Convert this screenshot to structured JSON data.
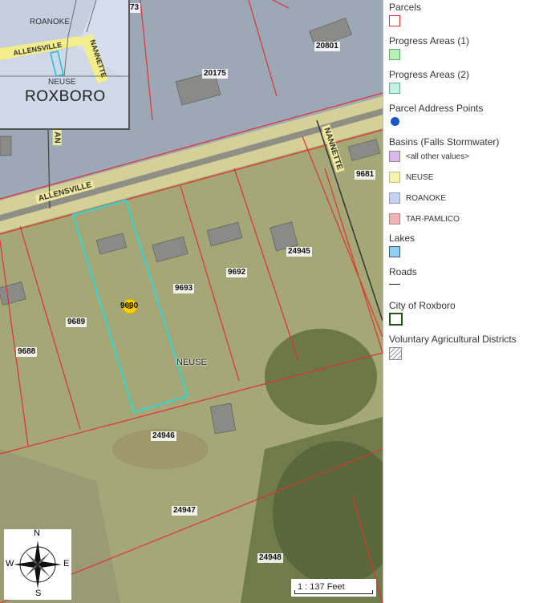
{
  "inset": {
    "labels": {
      "roanoke": "ROANOKE",
      "neuse": "NEUSE",
      "roxboro": "ROXBORO"
    },
    "roads": {
      "allensville": "ALLENSVILLE",
      "nannette": "NANNETTE"
    }
  },
  "map": {
    "roads": {
      "allensville": "ALLENSVILLE",
      "nannette": "NANNETTE",
      "side": "AN"
    },
    "parcel_labels": {
      "p20801": "20801",
      "p20175": "20175",
      "p73": "73",
      "p9681": "9681",
      "p24945": "24945",
      "p9692": "9692",
      "p9693": "9693",
      "p9689": "9689",
      "p9688": "9688",
      "p9690": "9690",
      "p24946": "24946",
      "p24947": "24947",
      "p24948": "24948"
    },
    "basin_label": "NEUSE",
    "address_point": {
      "label": "1",
      "color": "#f5d000"
    },
    "selected_parcel_color": "#33d6d6",
    "parcel_line_color": "#e23030"
  },
  "compass": {
    "n": "N",
    "s": "S",
    "e": "E",
    "w": "W"
  },
  "scale": {
    "text": "1 : 137 Feet"
  },
  "legend": {
    "parcels": {
      "title": "Parcels",
      "color": "#e23030"
    },
    "progress1": {
      "title": "Progress Areas (1)",
      "color": "#b6f0b6"
    },
    "progress2": {
      "title": "Progress Areas (2)",
      "color": "#bff3e6"
    },
    "address": {
      "title": "Parcel Address Points",
      "color": "#1a55c8"
    },
    "basins": {
      "title": "Basins (Falls Stormwater)",
      "items": [
        {
          "label": "<all other values>",
          "color": "#d9b8ec"
        },
        {
          "label": "NEUSE",
          "color": "#f6f3a6"
        },
        {
          "label": "ROANOKE",
          "color": "#c2d2f2"
        },
        {
          "label": "TAR-PAMLICO",
          "color": "#f3b2b2"
        }
      ]
    },
    "lakes": {
      "title": "Lakes",
      "color": "#8ed0f0"
    },
    "roads": {
      "title": "Roads"
    },
    "city": {
      "title": "City of Roxboro",
      "color": "#1f5a12"
    },
    "vad": {
      "title": "Voluntary Agricultural Districts"
    }
  }
}
